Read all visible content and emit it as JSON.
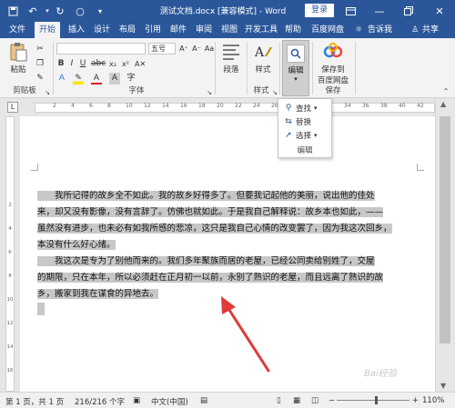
{
  "titlebar": {
    "title": "测试文档.docx [兼容模式] - Word",
    "login": "登录"
  },
  "tabs": [
    "文件",
    "开始",
    "插入",
    "设计",
    "布局",
    "引用",
    "邮件",
    "审阅",
    "视图",
    "开发工具",
    "帮助",
    "百度网盘"
  ],
  "tabs_right": {
    "tell_me": "告诉我",
    "share": "共享"
  },
  "ribbon": {
    "paste": "粘贴",
    "clipboard": "剪贴板",
    "font_size": "五号",
    "font_group": "字体",
    "paragraph": "段落",
    "styles": "样式",
    "styles_group": "样式",
    "editing": "编辑",
    "save_to_line1": "保存到",
    "save_to_line2": "百度网盘",
    "save_group": "保存"
  },
  "dropdown": {
    "find": "查找",
    "replace": "替换",
    "select": "选择",
    "group_label": "编辑"
  },
  "ruler_ticks": [
    "2",
    "4",
    "6",
    "8",
    "10",
    "12",
    "14",
    "16",
    "18",
    "20",
    "22",
    "24",
    "26",
    "28",
    "30",
    "32",
    "34",
    "36",
    "38",
    "40",
    "42"
  ],
  "vruler_ticks": [
    "2",
    "4",
    "6",
    "8",
    "10",
    "12",
    "14",
    "16"
  ],
  "document": {
    "para1_lines": [
      "　　我所记得的故乡全不如此。我的故乡好得多了。但要我记起他的美丽，说出他的佳处",
      "来，却又没有影像，没有言辞了。仿佛也就如此。于是我自己解释说：故乡本也如此，——",
      "虽然没有进步，也未必有如我所感的悲凉，这只是我自己心情的改变罢了，因为我这次回乡，",
      "本没有什么好心绪。"
    ],
    "para2_lines": [
      "　　我这次是专为了别他而来的。我们多年聚族而居的老屋，已经公同卖给别姓了，交屋",
      "的期限，只在本年，所以必须赶在正月初一以前，永别了熟识的老屋，而且远离了熟识的故",
      "乡，搬家到我在谋食的异地去。"
    ]
  },
  "status": {
    "page": "第 1 页，共 1 页",
    "words": "216/216 个字",
    "language": "中文(中国)",
    "zoom": "110%"
  },
  "colors": {
    "word_blue": "#2b579a",
    "selection": "#c8c8c8",
    "arrow": "#e03a3a"
  }
}
